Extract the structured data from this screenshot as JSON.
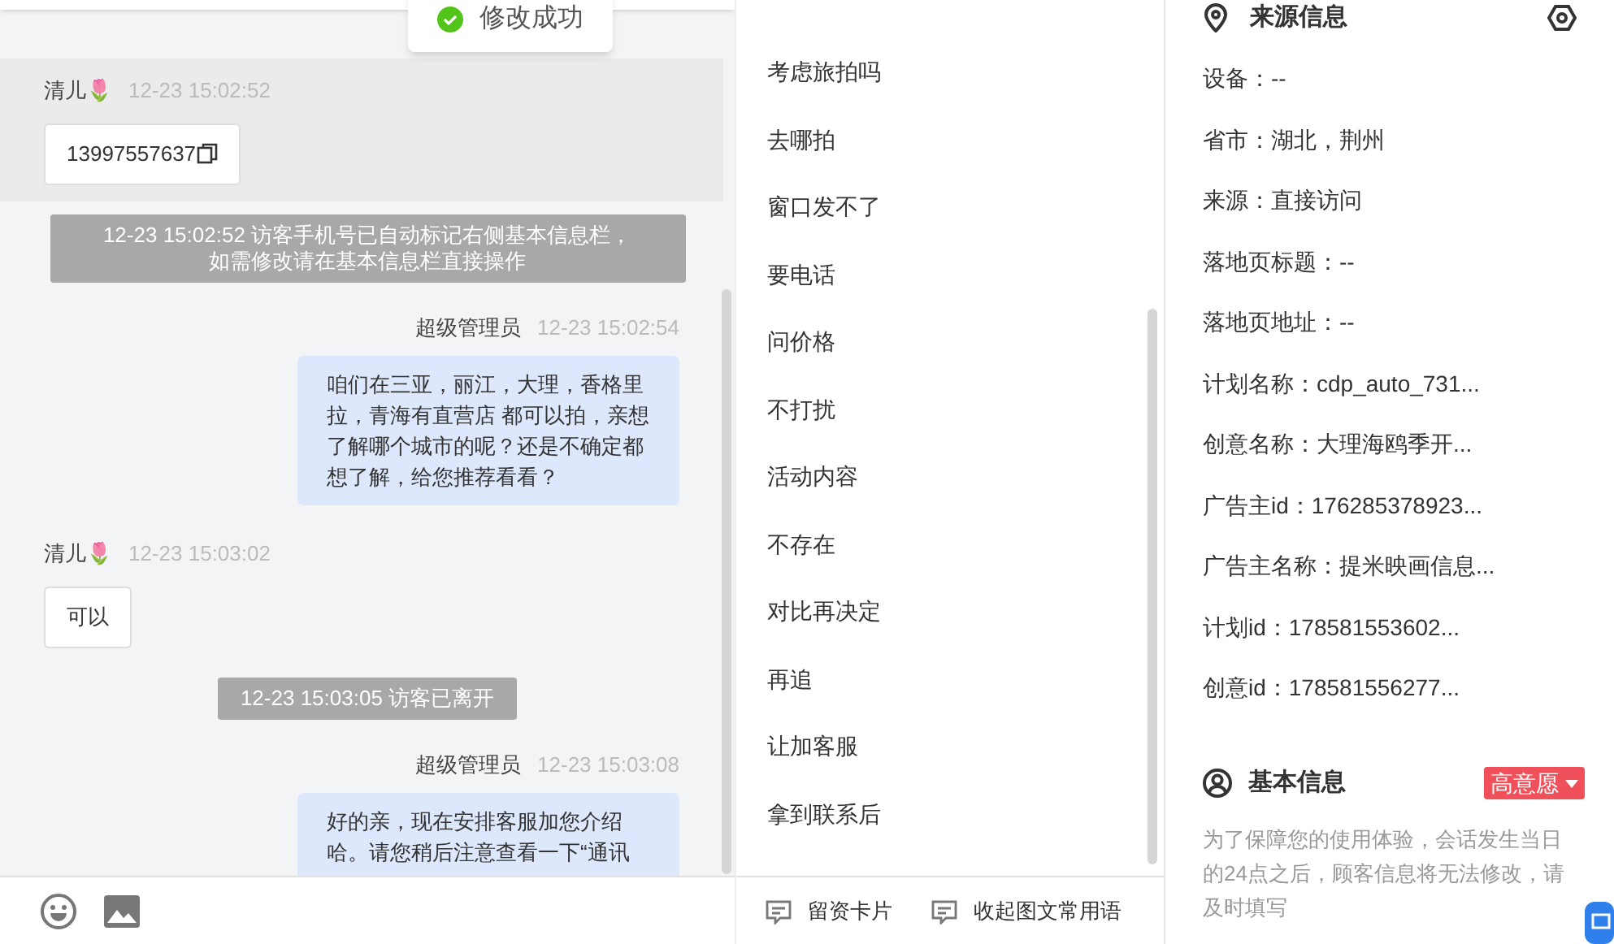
{
  "toast": {
    "text": "修改成功"
  },
  "chat": {
    "messages": [
      {
        "kind": "visitor",
        "sender": "清儿🌷",
        "time": "12-23 15:02:52",
        "text": "13997557637",
        "copyable": true,
        "selected": true
      },
      {
        "kind": "system",
        "lines": [
          "12-23 15:02:52 访客手机号已自动标记右侧基本信息栏，",
          "如需修改请在基本信息栏直接操作"
        ]
      },
      {
        "kind": "agent",
        "sender": "超级管理员",
        "time": "12-23 15:02:54",
        "text": "咱们在三亚，丽江，大理，香格里拉，青海有直营店 都可以拍，亲想了解哪个城市的呢？还是不确定都想了解，给您推荐看看？"
      },
      {
        "kind": "visitor",
        "sender": "清儿🌷",
        "time": "12-23 15:03:02",
        "text": "可以",
        "copyable": false,
        "selected": false
      },
      {
        "kind": "system",
        "lines": [
          "12-23 15:03:05 访客已离开"
        ]
      },
      {
        "kind": "agent",
        "sender": "超级管理员",
        "time": "12-23 15:03:08",
        "text": "好的亲，现在安排客服加您介绍哈。请您稍后注意查看一下“通讯"
      }
    ]
  },
  "quick_replies": {
    "items": [
      "考虑旅拍吗",
      "去哪拍",
      "窗口发不了",
      "要电话",
      "问价格",
      "不打扰",
      "活动内容",
      "不存在",
      "对比再决定",
      "再追",
      "让加客服",
      "拿到联系后"
    ],
    "footer": [
      "留资卡片",
      "收起图文常用语"
    ]
  },
  "source_info": {
    "title": "来源信息",
    "fields": [
      "设备：--",
      "省市：湖北，荆州",
      "来源：直接访问",
      "落地页标题：--",
      "落地页地址：--",
      "计划名称：cdp_auto_731...",
      "创意名称：大理海鸥季开...",
      "广告主id：176285378923...",
      "广告主名称：提米映画信息...",
      "计划id：178581553602...",
      "创意id：178581556277..."
    ]
  },
  "basic_info": {
    "title": "基本信息",
    "intent_tag": "高意愿",
    "notice": "为了保障您的使用体验，会话发生当日的24点之后，顾客信息将无法修改，请及时填写"
  }
}
